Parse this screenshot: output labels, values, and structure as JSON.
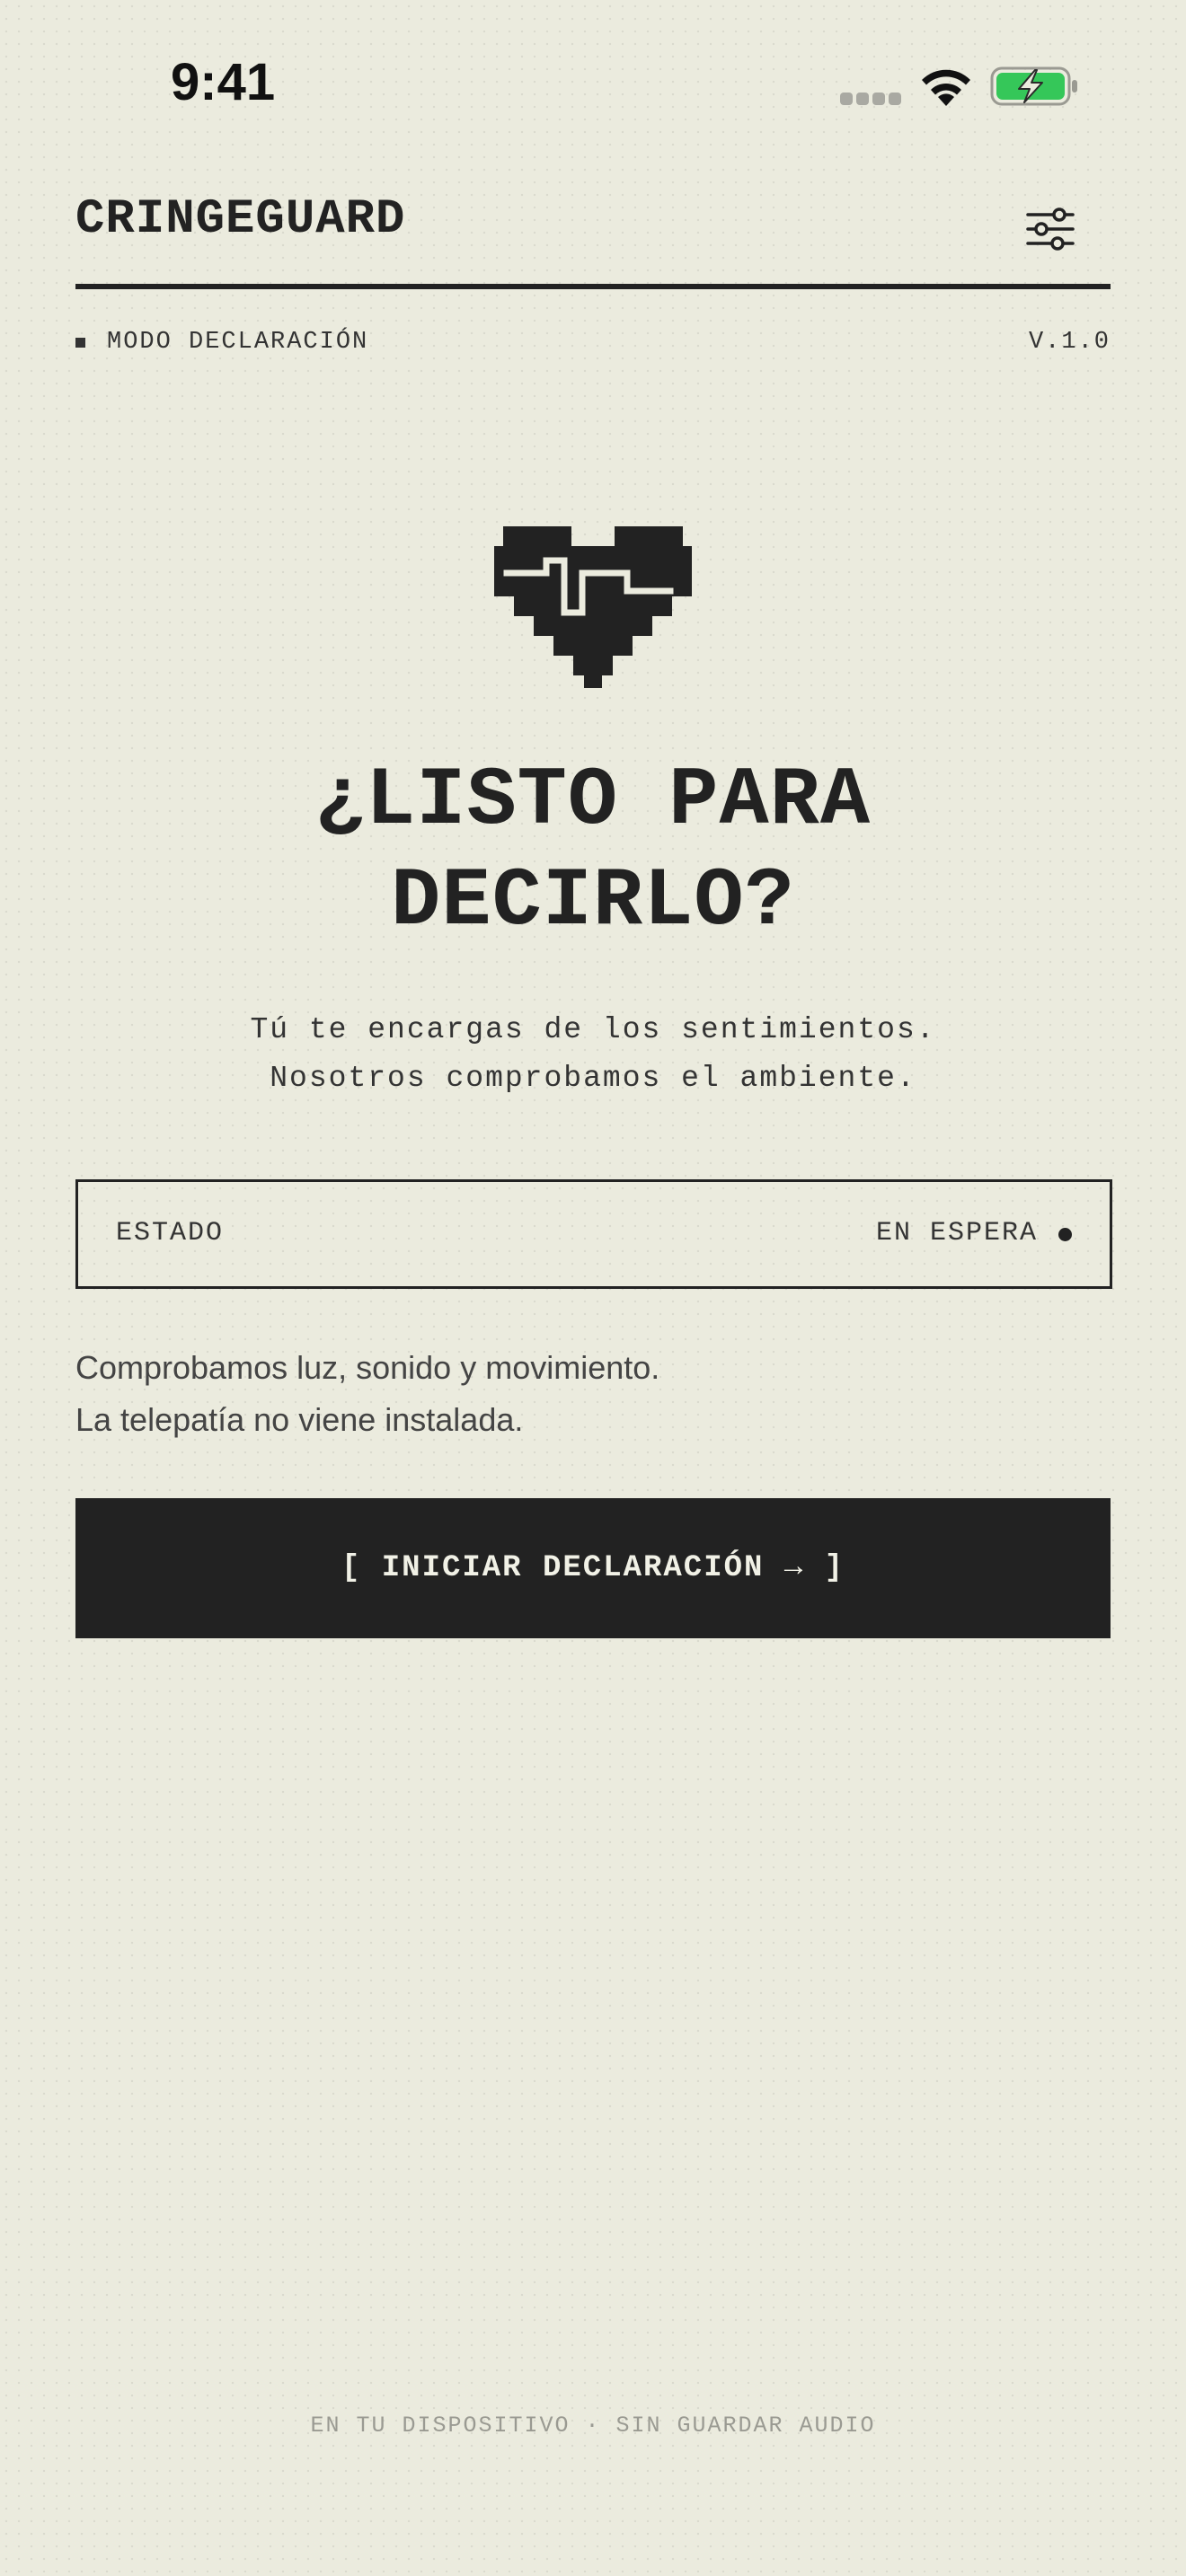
{
  "status_bar": {
    "time": "9:41",
    "icons": [
      "signal-icon",
      "wifi-icon",
      "battery-charging-icon"
    ],
    "battery_color": "#35c759"
  },
  "header": {
    "brand": "CRINGEGUARD",
    "settings_icon": "sliders-icon",
    "mode": "MODO DECLARACIÓN",
    "version": "V.1.0"
  },
  "hero": {
    "icon": "pixel-heart-pulse-icon",
    "headline_line1": "¿LISTO PARA",
    "headline_line2": "DECIRLO?",
    "subline_line1": "Tú te encargas de los sentimientos.",
    "subline_line2": "Nosotros comprobamos el ambiente."
  },
  "status": {
    "label": "ESTADO",
    "value": "EN ESPERA"
  },
  "info": {
    "line1": "Comprobamos luz, sonido y movimiento.",
    "line2": "La telepatía no viene instalada."
  },
  "cta": {
    "label": "[ INICIAR DECLARACIÓN → ]"
  },
  "footer": {
    "text": "EN TU DISPOSITIVO · SIN GUARDAR AUDIO"
  },
  "colors": {
    "background": "#ebebde",
    "ink": "#222222",
    "button_text": "#f1f1e6"
  }
}
